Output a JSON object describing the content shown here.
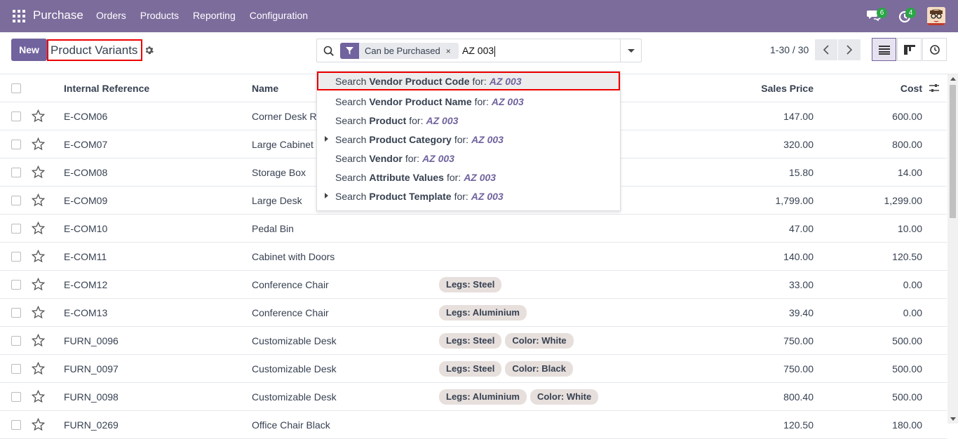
{
  "navbar": {
    "app_name": "Purchase",
    "menu": [
      "Orders",
      "Products",
      "Reporting",
      "Configuration"
    ],
    "chat_count": "6",
    "activity_count": "4"
  },
  "control": {
    "new_label": "New",
    "title": "Product Variants",
    "facet": "Can be Purchased",
    "search_value": "AZ 003",
    "pager": "1-30 / 30"
  },
  "dropdown": [
    {
      "prefix": "Search",
      "field": "Vendor Product Code",
      "suffix": "for:",
      "value": "AZ 003",
      "expandable": false
    },
    {
      "prefix": "Search",
      "field": "Vendor Product Name",
      "suffix": "for:",
      "value": "AZ 003",
      "expandable": false
    },
    {
      "prefix": "Search",
      "field": "Product",
      "suffix": "for:",
      "value": "AZ 003",
      "expandable": false
    },
    {
      "prefix": "Search",
      "field": "Product Category",
      "suffix": "for:",
      "value": "AZ 003",
      "expandable": true
    },
    {
      "prefix": "Search",
      "field": "Vendor",
      "suffix": "for:",
      "value": "AZ 003",
      "expandable": false
    },
    {
      "prefix": "Search",
      "field": "Attribute Values",
      "suffix": "for:",
      "value": "AZ 003",
      "expandable": false
    },
    {
      "prefix": "Search",
      "field": "Product Template",
      "suffix": "for:",
      "value": "AZ 003",
      "expandable": true
    }
  ],
  "table": {
    "headers": {
      "ref": "Internal Reference",
      "name": "Name",
      "price": "Sales Price",
      "cost": "Cost"
    },
    "rows": [
      {
        "ref": "E-COM06",
        "name": "Corner Desk Ri",
        "attrs": [],
        "price": "147.00",
        "cost": "600.00"
      },
      {
        "ref": "E-COM07",
        "name": "Large Cabinet",
        "attrs": [],
        "price": "320.00",
        "cost": "800.00"
      },
      {
        "ref": "E-COM08",
        "name": "Storage Box",
        "attrs": [],
        "price": "15.80",
        "cost": "14.00"
      },
      {
        "ref": "E-COM09",
        "name": "Large Desk",
        "attrs": [],
        "price": "1,799.00",
        "cost": "1,299.00"
      },
      {
        "ref": "E-COM10",
        "name": "Pedal Bin",
        "attrs": [],
        "price": "47.00",
        "cost": "10.00"
      },
      {
        "ref": "E-COM11",
        "name": "Cabinet with Doors",
        "attrs": [],
        "price": "140.00",
        "cost": "120.50"
      },
      {
        "ref": "E-COM12",
        "name": "Conference Chair",
        "attrs": [
          "Legs: Steel"
        ],
        "price": "33.00",
        "cost": "0.00"
      },
      {
        "ref": "E-COM13",
        "name": "Conference Chair",
        "attrs": [
          "Legs: Aluminium"
        ],
        "price": "39.40",
        "cost": "0.00"
      },
      {
        "ref": "FURN_0096",
        "name": "Customizable Desk",
        "attrs": [
          "Legs: Steel",
          "Color: White"
        ],
        "price": "750.00",
        "cost": "500.00"
      },
      {
        "ref": "FURN_0097",
        "name": "Customizable Desk",
        "attrs": [
          "Legs: Steel",
          "Color: Black"
        ],
        "price": "750.00",
        "cost": "500.00"
      },
      {
        "ref": "FURN_0098",
        "name": "Customizable Desk",
        "attrs": [
          "Legs: Aluminium",
          "Color: White"
        ],
        "price": "800.40",
        "cost": "500.00"
      },
      {
        "ref": "FURN_0269",
        "name": "Office Chair Black",
        "attrs": [],
        "price": "120.50",
        "cost": "180.00"
      }
    ]
  }
}
